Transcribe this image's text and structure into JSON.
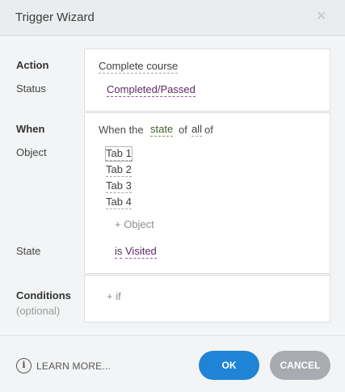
{
  "window": {
    "title": "Trigger Wizard",
    "close_glyph": "✕"
  },
  "labels": {
    "action": "Action",
    "status": "Status",
    "when": "When",
    "object": "Object",
    "state": "State",
    "conditions": "Conditions",
    "conditions_hint": "(optional)"
  },
  "action": {
    "value": "Complete course",
    "status": "Completed/Passed"
  },
  "when": {
    "prefix": "When the",
    "state_word": "state",
    "of_word": "of",
    "quantifier": "all",
    "of_suffix": "of",
    "objects": [
      "Tab 1",
      "Tab 2",
      "Tab 3",
      "Tab 4"
    ],
    "add_object": "+ Object",
    "state_is": "is",
    "state_value": "Visited"
  },
  "conditions": {
    "add_if": "+ if"
  },
  "footer": {
    "info_icon_glyph": "i",
    "learn_more": "LEARN MORE...",
    "ok": "OK",
    "cancel": "CANCEL"
  },
  "colors": {
    "primary_button": "#1f84d6",
    "secondary_button": "#a8acb0",
    "accent_purple": "#5a2a62"
  }
}
